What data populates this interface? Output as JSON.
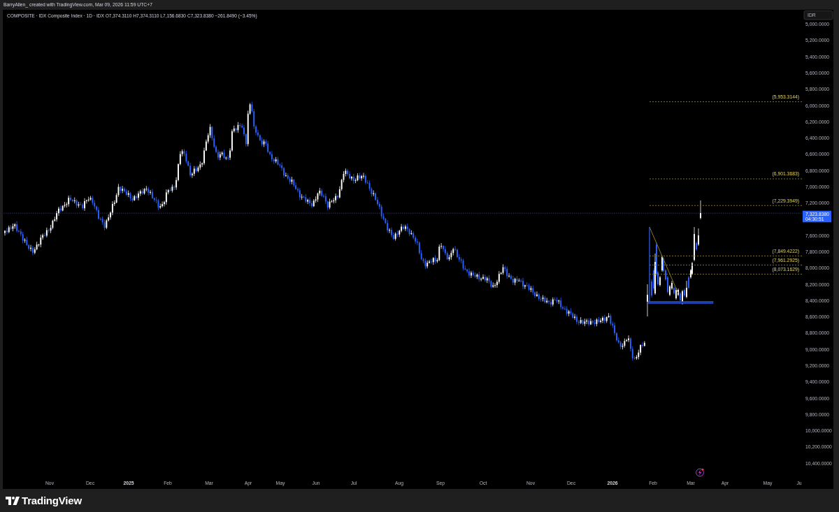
{
  "caption": "BarryAllen_ created with TradingView.com, Mar 09, 2026 11:59 UTC+7",
  "legend": {
    "title": "COMPOSITE · IDX Composite Index · 1D · IDX",
    "ohlc": [
      {
        "label": "O",
        "value": "7,374.3110"
      },
      {
        "label": "H",
        "value": "7,374.3110"
      },
      {
        "label": "L",
        "value": "7,156.6830"
      },
      {
        "label": "C",
        "value": "7,323.8380"
      }
    ],
    "change": "−261.8490 (−3.45%)"
  },
  "currency_button": "IDR",
  "price_axis": {
    "labels": [
      "5,000.0000",
      "5,200.0000",
      "5,400.0000",
      "5,600.0000",
      "5,800.0000",
      "6,000.0000",
      "6,200.0000",
      "6,400.0000",
      "6,600.0000",
      "6,800.0000",
      "7,000.0000",
      "7,200.0000",
      "7,600.0000",
      "7,800.0000",
      "8,000.0000",
      "8,200.0000",
      "8,400.0000",
      "8,600.0000",
      "8,800.0000",
      "9,000.0000",
      "9,200.0000",
      "9,400.0000",
      "9,600.0000",
      "9,800.0000",
      "10,000.0000",
      "10,200.0000",
      "10,400.0000"
    ]
  },
  "price_levels": [
    "(5,953.3144)",
    "(6,901.3683)",
    "(7,229.3949)",
    "(7,849.4222)",
    "(7,961.2925)",
    "(8,073.1629)"
  ],
  "current_price": {
    "price": "7,323.8380",
    "countdown": "04:30:51"
  },
  "time_axis": {
    "labels": [
      {
        "text": "Nov",
        "kind": "month"
      },
      {
        "text": "Dec",
        "kind": "month"
      },
      {
        "text": "2025",
        "kind": "year"
      },
      {
        "text": "Feb",
        "kind": "month"
      },
      {
        "text": "Mar",
        "kind": "month"
      },
      {
        "text": "Apr",
        "kind": "month"
      },
      {
        "text": "May",
        "kind": "month"
      },
      {
        "text": "Jun",
        "kind": "month"
      },
      {
        "text": "Jul",
        "kind": "month"
      },
      {
        "text": "Aug",
        "kind": "month"
      },
      {
        "text": "Sep",
        "kind": "month"
      },
      {
        "text": "Oct",
        "kind": "month"
      },
      {
        "text": "Nov",
        "kind": "month"
      },
      {
        "text": "Dec",
        "kind": "month"
      },
      {
        "text": "2026",
        "kind": "year"
      },
      {
        "text": "Feb",
        "kind": "month"
      },
      {
        "text": "Mar",
        "kind": "month"
      },
      {
        "text": "Apr",
        "kind": "month"
      },
      {
        "text": "May",
        "kind": "month"
      },
      {
        "text": "Ju",
        "kind": "month"
      }
    ]
  },
  "footer": {
    "brand": "TradingView"
  }
}
